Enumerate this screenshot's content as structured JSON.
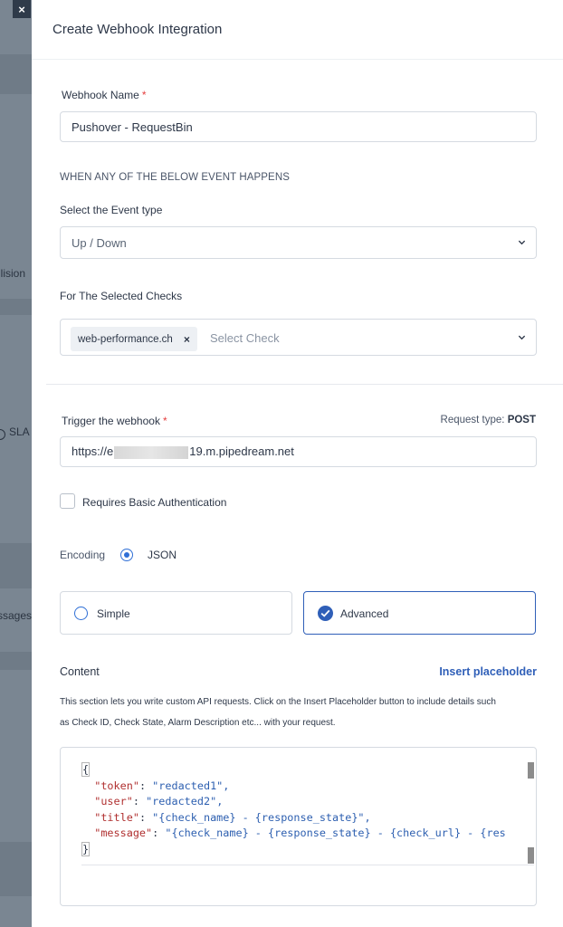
{
  "backdrop": {
    "close_glyph": "×",
    "text_lision": "llision",
    "text_sla": "SLA",
    "text_ssages": "ssages"
  },
  "panel": {
    "title": "Create Webhook Integration"
  },
  "webhook_name": {
    "label": "Webhook Name",
    "required": "*",
    "value": "Pushover - RequestBin"
  },
  "event_section": {
    "caption": "WHEN ANY OF THE BELOW EVENT HAPPENS",
    "event_type_label": "Select the Event type",
    "event_type_value": "Up / Down",
    "checks_label": "For The Selected Checks",
    "selected_check": "web-performance.ch",
    "chip_remove": "×",
    "check_placeholder": "Select Check"
  },
  "trigger": {
    "label": "Trigger the webhook",
    "required": "*",
    "request_type_label": "Request type:",
    "request_type_value": "POST",
    "url_prefix": "https://e",
    "url_suffix": "19.m.pipedream.net"
  },
  "auth": {
    "label": "Requires Basic Authentication",
    "checked": false
  },
  "encoding": {
    "label": "Encoding",
    "option": "JSON"
  },
  "mode": {
    "simple_label": "Simple",
    "advanced_label": "Advanced",
    "selected": "Advanced"
  },
  "content": {
    "label": "Content",
    "insert_link": "Insert placeholder",
    "help_line1": "This section lets you write custom API requests. Click on the Insert Placeholder button to include details such",
    "help_line2": "as Check ID, Check State, Alarm Description etc... with your request."
  },
  "code": {
    "open_brace": "{",
    "close_brace": "}",
    "lines": [
      {
        "key": "\"token\"",
        "value": "\"redacted1\","
      },
      {
        "key": "\"user\"",
        "value": "\"redacted2\","
      },
      {
        "key": "\"title\"",
        "value": "\"{check_name} - {response_state}\","
      },
      {
        "key": "\"message\"",
        "value": "\"{check_name} - {response_state} - {check_url} - {res"
      }
    ]
  },
  "colors": {
    "accent": "#2f5fb8",
    "required": "#e53e3e",
    "json_key": "#b03030",
    "json_string": "#2d5fb0"
  }
}
